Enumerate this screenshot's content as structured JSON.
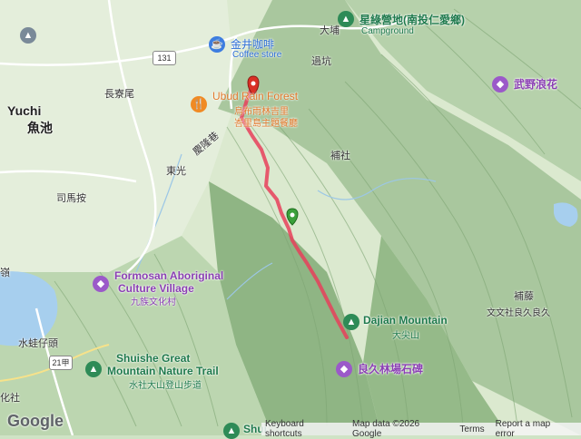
{
  "colors": {
    "track": "#e8405a",
    "start_marker": "#3aa03a",
    "end_marker": "#d93025",
    "water": "#a7cfee",
    "flat_land": "#dbe9cf",
    "mountain": "#9fbf94"
  },
  "markers": {
    "start_icon": "green-pin-icon",
    "end_icon": "red-pin-icon"
  },
  "labels": {
    "dapu": "大埔",
    "camp_name": "星綠營地(南投仁愛鄉)",
    "camp_type": "Campground",
    "coffee_name": "金井咖啡",
    "coffee_type": "Coffee store",
    "guokeng": "過坑",
    "yuchi_en": "Yuchi",
    "yuchi_zh": "魚池",
    "changjiawei": "長寮尾",
    "road_131": "131",
    "ubud_en": "Ubud Rain Forest",
    "ubud_zh1": "烏布雨林吉里",
    "ubud_zh2": "峇里島主題餐廳",
    "wuye": "武野浪花",
    "dongguang": "東光",
    "qinglongxiang": "慶隆巷",
    "bushe": "補社",
    "simaan": "司馬按",
    "formosan_en1": "Formosan Aboriginal",
    "formosan_en2": "Culture Village",
    "formosan_zh": "九族文化村",
    "ling": "嶺",
    "dajian_en": "Dajian Mountain",
    "dajian_zh": "大尖山",
    "bufan": "補藤",
    "wenwenshe": "文文社良久良久",
    "shuiwazitou": "水蛙仔頭",
    "road_21": "21甲",
    "shuishe_en1": "Shuishe Great",
    "shuishe_en2": "Mountain Nature Trail",
    "shuishe_zh": "水社大山登山步道",
    "liangjiu": "良久林場石碑",
    "huashe": "化社",
    "shui_bottom": "Shui",
    "google": "Google"
  },
  "footer": {
    "shortcuts": "Keyboard shortcuts",
    "map_data": "Map data ©2026 Google",
    "terms": "Terms",
    "report": "Report a map error"
  }
}
